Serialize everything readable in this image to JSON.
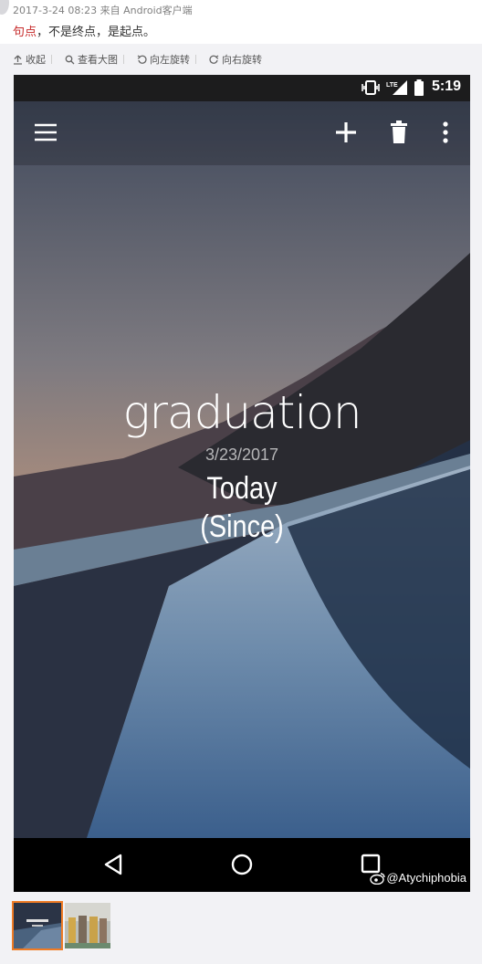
{
  "post": {
    "meta": "2017-3-24 08:23 来自 Android客户端",
    "highlight": "句点",
    "text": "，不是终点，是起点。"
  },
  "toolbar": {
    "collapse": "收起",
    "view_large": "查看大图",
    "rotate_left": "向左旋转",
    "rotate_right": "向右旋转"
  },
  "phone": {
    "status_time": "5:19",
    "network": "LTE",
    "event": {
      "title": "graduation",
      "date": "3/23/2017",
      "status_line1": "Today",
      "status_line2": "(Since)"
    },
    "watermark": "@Atychiphobia"
  },
  "icons": [
    "upload-icon",
    "search-icon",
    "rotate-left-icon",
    "rotate-right-icon",
    "vibrate-icon",
    "signal-icon",
    "battery-icon",
    "menu-icon",
    "add-icon",
    "delete-icon",
    "more-icon",
    "back-icon",
    "home-icon",
    "recents-icon",
    "weibo-icon"
  ],
  "colors": {
    "highlight": "#c62828",
    "thumb_border": "#f07b24"
  }
}
